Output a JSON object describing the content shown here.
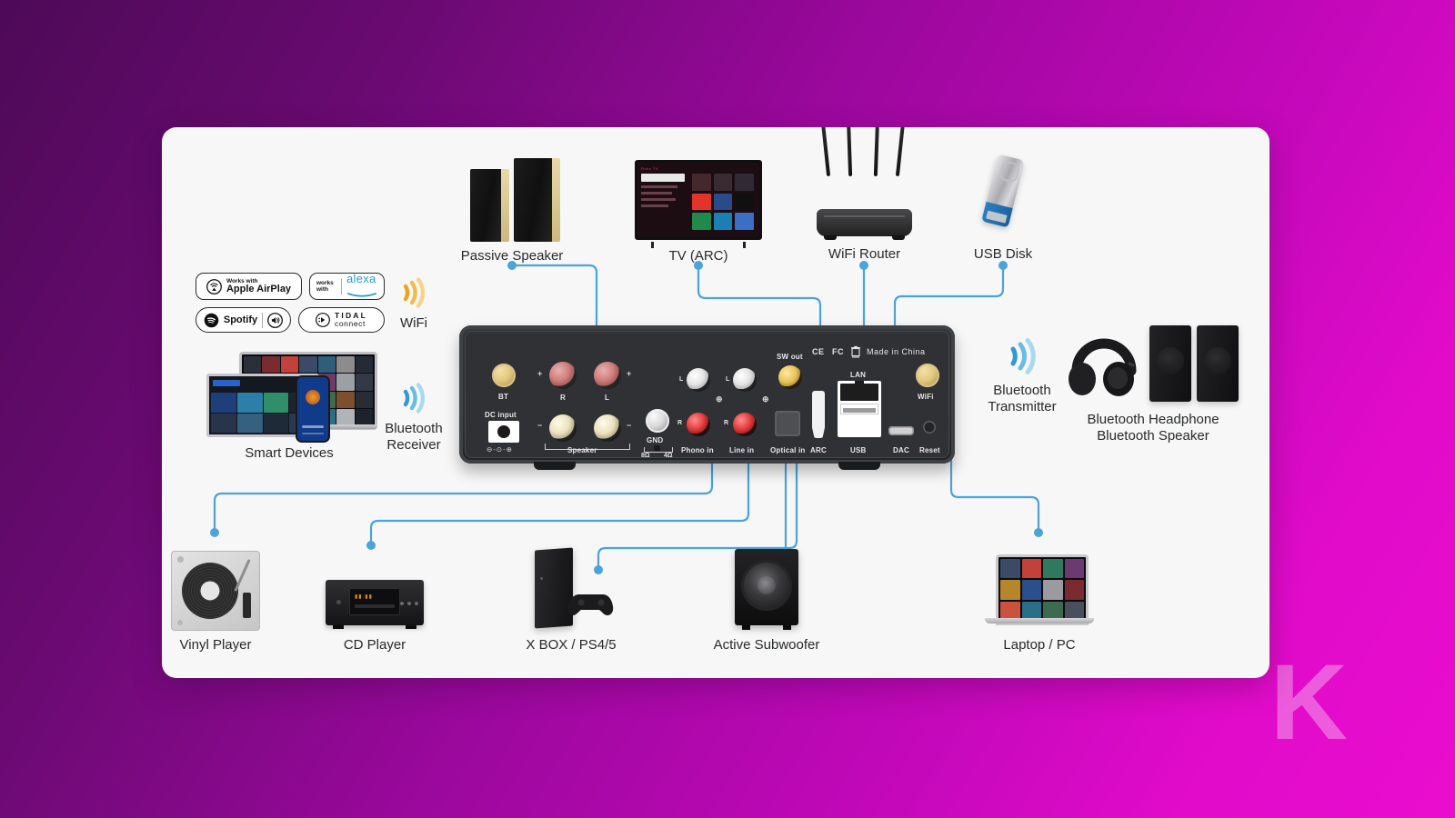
{
  "background": {
    "gradient_from": "#4d0a57",
    "gradient_to": "#ea0dcf",
    "watermark": "K"
  },
  "card": {
    "background": "#f7f7f7"
  },
  "accent": {
    "line_color": "#4ba3d8",
    "wifi_wave": "#f0a71e",
    "bluetooth_wave": "#4aa8dd"
  },
  "badges": [
    {
      "id": "apple-airplay",
      "small_text": "Works with",
      "main_text": "Apple AirPlay"
    },
    {
      "id": "alexa",
      "small_text": "works with",
      "main_text": "alexa"
    },
    {
      "id": "spotify",
      "main_text": "Spotify"
    },
    {
      "id": "tidal",
      "main_text": "TIDAL",
      "sub_text": "connect"
    }
  ],
  "wireless": [
    {
      "id": "wifi",
      "label": "WiFi",
      "color": "#f0a71e"
    },
    {
      "id": "bluetooth-receiver",
      "label": "Bluetooth\nReceiver",
      "line1": "Bluetooth",
      "line2": "Receiver",
      "color": "#4aa8dd"
    }
  ],
  "left_devices": [
    {
      "id": "smart-devices",
      "label": "Smart Devices"
    }
  ],
  "top_devices": [
    {
      "id": "passive-speaker",
      "label": "Passive Speaker"
    },
    {
      "id": "tv-arc",
      "label": "TV (ARC)"
    },
    {
      "id": "wifi-router",
      "label": "WiFi Router"
    },
    {
      "id": "usb-disk",
      "label": "USB Disk"
    }
  ],
  "bottom_devices": [
    {
      "id": "vinyl-player",
      "label": "Vinyl Player"
    },
    {
      "id": "cd-player",
      "label": "CD Player"
    },
    {
      "id": "xbox-ps",
      "label": "X BOX / PS4/5"
    },
    {
      "id": "active-subwoofer",
      "label": "Active Subwoofer"
    },
    {
      "id": "laptop-pc",
      "label": "Laptop / PC"
    }
  ],
  "right_devices": [
    {
      "id": "bluetooth-transmitter",
      "line1": "Bluetooth",
      "line2": "Transmitter"
    },
    {
      "id": "bluetooth-headphone-speaker",
      "line1": "Bluetooth Headphone",
      "line2": "Bluetooth Speaker"
    }
  ],
  "amplifier": {
    "port_labels": {
      "bt": "BT",
      "dc_input": "DC input",
      "dc_polarity": "⊖-⊙-⊕",
      "speaker": "Speaker",
      "speaker_r": "R",
      "speaker_l": "L",
      "plus": "+",
      "minus": "−",
      "gnd": "GND",
      "impedance_8": "8Ω",
      "impedance_4": "4Ω",
      "phono_in": "Phono in",
      "line_in": "Line in",
      "optical_in": "Optical in",
      "sw_out": "SW out",
      "arc": "ARC",
      "lan": "LAN",
      "usb": "USB",
      "dac": "DAC",
      "reset": "Reset",
      "wifi": "WiFi",
      "rca_l": "L",
      "rca_r": "R"
    },
    "certifications": [
      "CE",
      "FC",
      "WEEE",
      "Made in China"
    ],
    "made_in": "Made in China"
  }
}
